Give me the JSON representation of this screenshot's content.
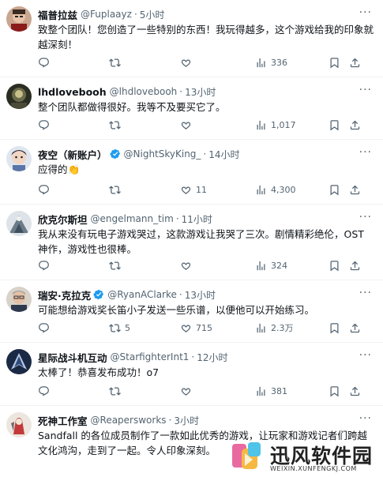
{
  "tweets": [
    {
      "name": "福普拉兹",
      "handle": "@Fuplaayz",
      "time": "5小时",
      "verified": false,
      "text": "致整个团队！您创造了一些特别的东西！我玩得越多，这个游戏给我的印象就越深刻！",
      "replies": "",
      "retweets": "",
      "likes": "",
      "views": "336",
      "avatar": "avatar-1"
    },
    {
      "name": "lhdlovebooh",
      "handle": "@lhdlovebooh",
      "time": "13小时",
      "verified": false,
      "text": "整个团队都做得很好。我等不及要买它了。",
      "replies": "",
      "retweets": "",
      "likes": "",
      "views": "1,017",
      "avatar": "avatar-2"
    },
    {
      "name": "夜空（新账户）",
      "handle": "@NightSkyKing_",
      "time": "14小时",
      "verified": true,
      "text": "应得的👏",
      "replies": "",
      "retweets": "",
      "likes": "11",
      "views": "4,300",
      "avatar": "avatar-3"
    },
    {
      "name": "欣克尔斯坦",
      "handle": "@engelmann_tim",
      "time": "11小时",
      "verified": false,
      "text": "我从来没有玩电子游戏哭过，这款游戏让我哭了三次。剧情精彩绝伦，OST 神作，游戏性也很棒。",
      "replies": "",
      "retweets": "",
      "likes": "",
      "views": "324",
      "avatar": "avatar-4"
    },
    {
      "name": "瑞安·克拉克",
      "handle": "@RyanAClarke",
      "time": "13小时",
      "verified": true,
      "text": "可能想给游戏奖长笛小子发送一些乐谱，以便他可以开始练习。",
      "replies": "",
      "retweets": "5",
      "likes": "715",
      "views": "2.3万",
      "avatar": "avatar-5"
    },
    {
      "name": "星际战斗机互动",
      "handle": "@StarfighterInt1",
      "time": "12小时",
      "verified": false,
      "text": "太棒了！恭喜发布成功！o7",
      "replies": "",
      "retweets": "",
      "likes": "",
      "views": "381",
      "avatar": "avatar-6"
    },
    {
      "name": "死神工作室",
      "handle": "@Reapersworks",
      "time": "3小时",
      "verified": false,
      "text": "Sandfall 的各位成员制作了一款如此优秀的游戏，让玩家和游戏记者们跨越文化鸿沟，走到了一起。令人印象深刻。",
      "replies": "",
      "retweets": "",
      "likes": "",
      "views": "",
      "avatar": "avatar-7"
    }
  ],
  "more_label": "···",
  "separator": "·",
  "watermark": {
    "title": "迅风软件园",
    "url": "WEIXIN.XUNFENGKJ.COM"
  },
  "colors": {
    "text": "#0f1419",
    "muted": "#536471",
    "verified": "#1d9bf0",
    "divider": "#eff3f4"
  }
}
